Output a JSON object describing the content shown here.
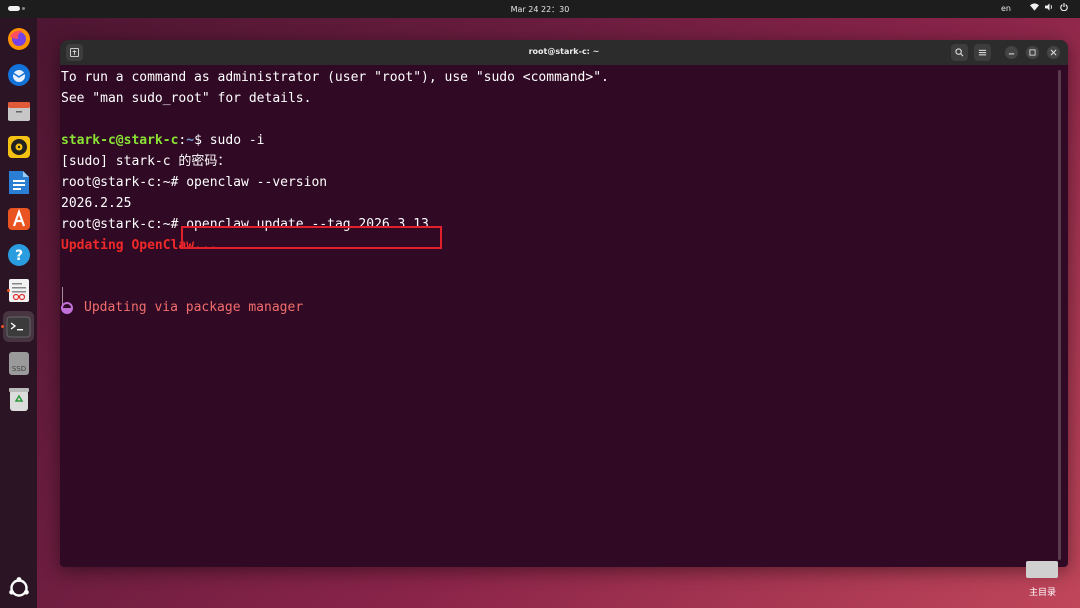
{
  "topbar": {
    "clock": "Mar 24  22：30",
    "language": "en"
  },
  "dock": {
    "items": [
      {
        "name": "firefox-icon"
      },
      {
        "name": "thunderbird-icon"
      },
      {
        "name": "files-icon"
      },
      {
        "name": "rhythmbox-icon"
      },
      {
        "name": "libreoffice-writer-icon"
      },
      {
        "name": "app-center-icon"
      },
      {
        "name": "help-icon"
      },
      {
        "name": "text-editor-icon"
      },
      {
        "name": "terminal-icon"
      },
      {
        "name": "ssd-drive-icon"
      },
      {
        "name": "trash-icon"
      }
    ],
    "ssd_label": "SSD"
  },
  "window": {
    "title": "root@stark-c: ~"
  },
  "terminal": {
    "line1": "To run a command as administrator (user \"root\"), use \"sudo <command>\".",
    "line2": "See \"man sudo_root\" for details.",
    "prompt_user": "stark-c@stark-c",
    "prompt_sep": ":",
    "prompt_path": "~",
    "prompt_cmd": "$ sudo -i",
    "line4": "[sudo] stark-c 的密码：",
    "line5": "root@stark-c:~# openclaw --version",
    "line6": "2026.2.25",
    "line7_prompt": "root@stark-c:~#",
    "line7_cmd": " openclaw update --tag 2026.3.13",
    "line8": "Updating OpenClaw...",
    "status": "Updating via package manager"
  },
  "desktop": {
    "home_label": "主目录"
  },
  "colors": {
    "terminal_bg": "#300a24",
    "prompt_green": "#8ae234",
    "path_blue": "#729fcf",
    "error_red": "#ef2929",
    "highlight_box": "#e0202a"
  }
}
